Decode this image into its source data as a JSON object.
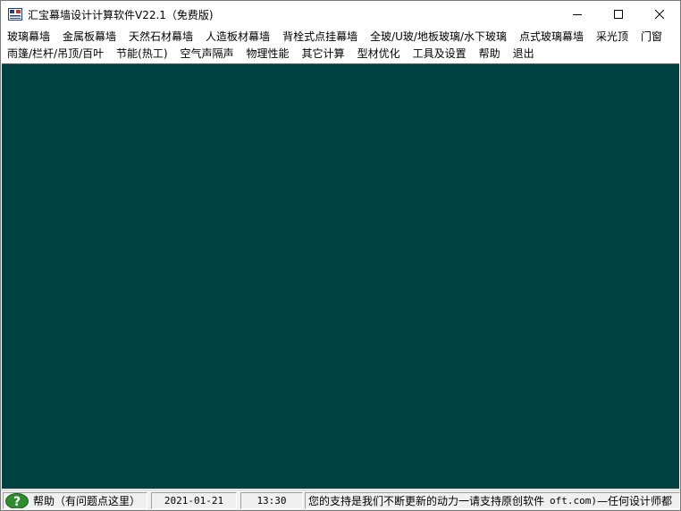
{
  "window": {
    "title": "汇宝幕墙设计计算软件V22.1（免费版)"
  },
  "menu": {
    "row1": [
      "玻璃幕墙",
      "金属板幕墙",
      "天然石材幕墙",
      "人造板材幕墙",
      "背栓式点挂幕墙",
      "全玻/U玻/地板玻璃/水下玻璃",
      "点式玻璃幕墙",
      "采光顶",
      "门窗"
    ],
    "row2": [
      "雨篷/栏杆/吊顶/百叶",
      "节能(热工)",
      "空气声隔声",
      "物理性能",
      "其它计算",
      "型材优化",
      "工具及设置",
      "帮助",
      "退出"
    ]
  },
  "statusbar": {
    "help_text": "帮助（有问题点这里）",
    "date": "2021-01-21",
    "time": "13:30",
    "marquee_text": "您的支持是我们不断更新的动力一请支持原创软件",
    "marquee_url": "oft.com)",
    "marquee_tail": "—任何设计师都"
  },
  "colors": {
    "client_background": "#004242",
    "statusbar_background": "#f0f0f0",
    "help_icon": "#2e8b2e"
  },
  "icons": {
    "app": "app-icon",
    "minimize": "minimize-icon",
    "maximize": "maximize-icon",
    "close": "close-icon",
    "help": "question-mark-icon"
  }
}
